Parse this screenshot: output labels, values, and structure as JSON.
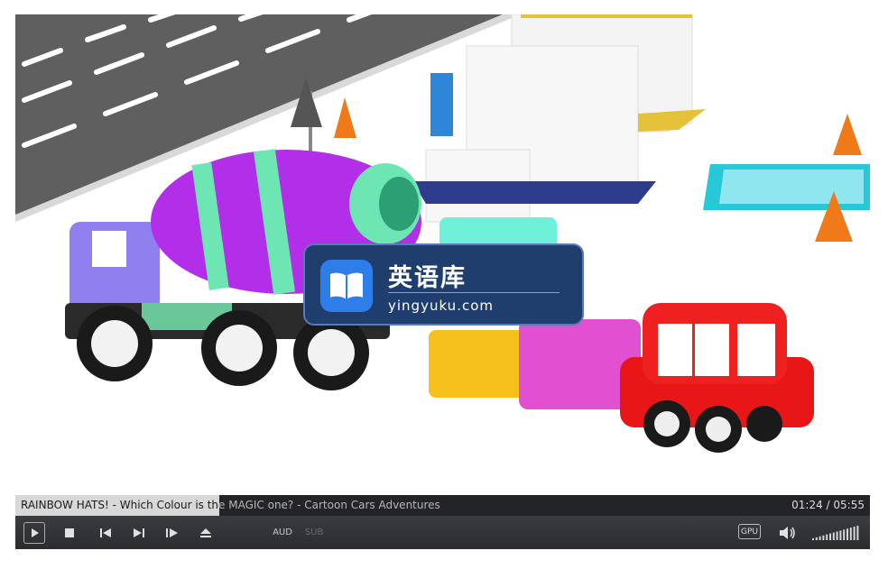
{
  "video": {
    "title": "RAINBOW HATS! - Which Colour is the MAGIC one? - Cartoon Cars Adventures",
    "time": "01:24 / 05:55",
    "progress_fraction": 0.239
  },
  "watermark": {
    "title": "英语库",
    "url": "yingyuku.com"
  },
  "controls": {
    "play_icon": "play-icon",
    "stop_icon": "stop-icon",
    "prev_icon": "previous-icon",
    "next_icon": "next-icon",
    "frame_step_icon": "frame-step-icon",
    "eject_icon": "eject-icon",
    "audio_label": "AUD",
    "subtitle_label": "SUB",
    "gpu_label": "GPU",
    "volume_icon": "speaker-icon",
    "volume_level": 1.0
  }
}
